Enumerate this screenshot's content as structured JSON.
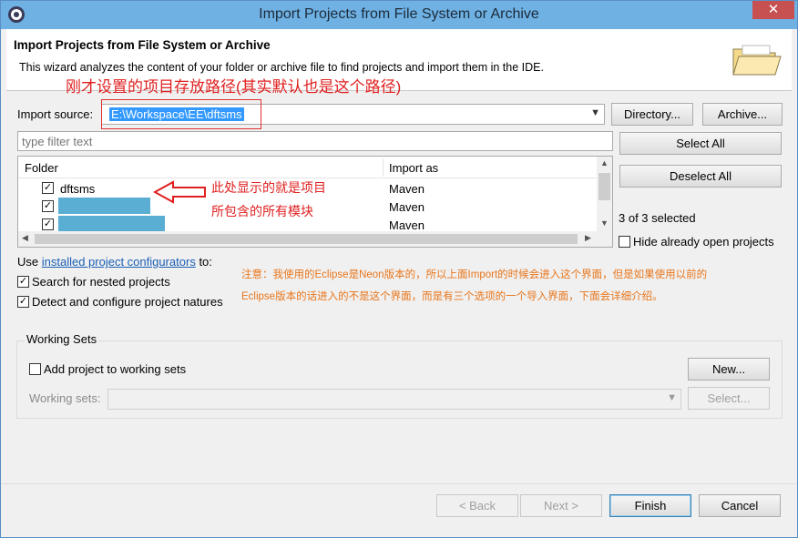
{
  "window": {
    "title": "Import Projects from File System or Archive",
    "close_glyph": "✕"
  },
  "header": {
    "title": "Import Projects from File System or Archive",
    "description": "This wizard analyzes the content of your folder or archive file to find projects and import them in the IDE.",
    "icon": "folder-open-icon"
  },
  "annotations": {
    "path_note": "刚才设置的项目存放路径(其实默认也是这个路径)",
    "project_note_line1": "此处显示的就是项目",
    "project_note_line2": "所包含的所有模块",
    "eclipse_note_line1": "注意：我使用的Eclipse是Neon版本的，所以上面Import的时候会进入这个界面，但是如果使用以前的",
    "eclipse_note_line2": "Eclipse版本的话进入的不是这个界面，而是有三个选项的一个导入界面，下面会详细介绍。"
  },
  "import_source": {
    "label": "Import source:",
    "value": "E:\\Workspace\\EE\\dftsms",
    "directory_button": "Directory...",
    "archive_button": "Archive..."
  },
  "filter": {
    "placeholder": "type filter text"
  },
  "table": {
    "columns": [
      "Folder",
      "Import as"
    ],
    "rows": [
      {
        "folder": "dftsms",
        "import_as": "Maven",
        "checked": true
      },
      {
        "folder": "",
        "import_as": "Maven",
        "checked": true
      },
      {
        "folder": "",
        "import_as": "Maven",
        "checked": true
      }
    ]
  },
  "selection": {
    "select_all": "Select All",
    "deselect_all": "Deselect All",
    "status": "3 of 3 selected",
    "hide_open": "Hide already open projects"
  },
  "options": {
    "use_prefix": "Use ",
    "configurators_link": "installed project configurators",
    "use_suffix": " to:",
    "nested": "Search for nested projects",
    "natures": "Detect and configure project natures"
  },
  "working_sets": {
    "group_title": "Working Sets",
    "add_label": "Add project to working sets",
    "new_button": "New...",
    "sets_label": "Working sets:",
    "select_button": "Select..."
  },
  "footer": {
    "back": "< Back",
    "next": "Next >",
    "finish": "Finish",
    "cancel": "Cancel"
  },
  "colors": {
    "annotation_red": "#e02020",
    "note_orange": "#e8751a",
    "selection_blue": "#3399ff"
  }
}
